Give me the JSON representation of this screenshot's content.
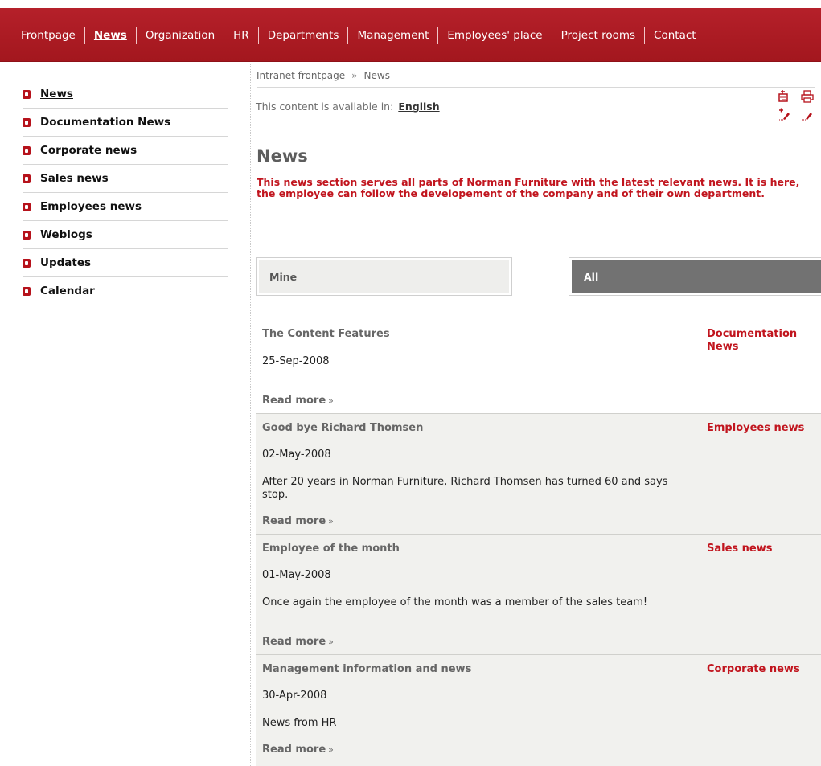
{
  "nav": {
    "items": [
      {
        "label": "Frontpage"
      },
      {
        "label": "News"
      },
      {
        "label": "Organization"
      },
      {
        "label": "HR"
      },
      {
        "label": "Departments"
      },
      {
        "label": "Management"
      },
      {
        "label": "Employees' place"
      },
      {
        "label": "Project rooms"
      },
      {
        "label": "Contact"
      }
    ],
    "active": "News",
    "color": "#b01c24"
  },
  "sidebar": {
    "items": [
      {
        "label": "News"
      },
      {
        "label": "Documentation News"
      },
      {
        "label": "Corporate news"
      },
      {
        "label": "Sales news"
      },
      {
        "label": "Employees news"
      },
      {
        "label": "Weblogs"
      },
      {
        "label": "Updates"
      },
      {
        "label": "Calendar"
      }
    ],
    "active": "News",
    "bullet_color": "#b6121b"
  },
  "breadcrumb": {
    "home": "Intranet frontpage",
    "separator": "»",
    "current": "News"
  },
  "availability": {
    "text": "This content is available in:",
    "language": "English"
  },
  "tools": {
    "icons": [
      "send-page-icon",
      "print-icon",
      "new-page-icon",
      "edit-page-icon"
    ]
  },
  "page": {
    "title": "News",
    "intro": "This news section serves all parts of Norman Furniture with the latest relevant news. It is here, the employee can follow the developement of the company and of their own department."
  },
  "tabs": {
    "mine": "Mine",
    "all": "All",
    "selected": "All"
  },
  "news": [
    {
      "title": "The Content Features",
      "category": "Documentation News",
      "date": "25-Sep-2008",
      "description": "",
      "more": "Read more",
      "arrow": "»"
    },
    {
      "title": "Good bye Richard Thomsen",
      "category": "Employees news",
      "date": "02-May-2008",
      "description": "After 20 years in Norman Furniture, Richard Thomsen has turned 60 and says stop.",
      "more": "Read more",
      "arrow": "»"
    },
    {
      "title": "Employee of the month",
      "category": "Sales news",
      "date": "01-May-2008",
      "description": "Once again the employee of the month was a member of the sales team!",
      "more": "Read more",
      "arrow": "»"
    },
    {
      "title": "Management information and news",
      "category": "Corporate news",
      "date": "30-Apr-2008",
      "description": "News from HR",
      "more": "Read more",
      "arrow": "»"
    }
  ]
}
